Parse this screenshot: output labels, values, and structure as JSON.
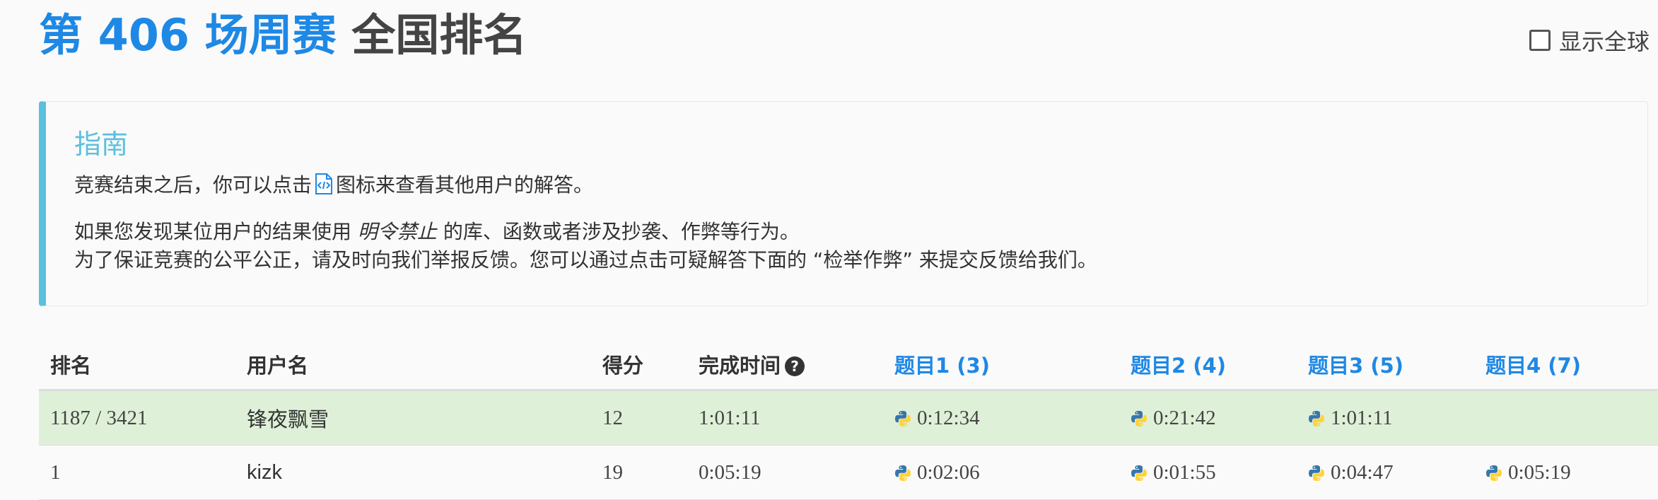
{
  "title": {
    "contest": "第 406 场周赛",
    "rest": "全国排名"
  },
  "global_toggle": {
    "label": "显示全球",
    "checked": false
  },
  "guide": {
    "heading": "指南",
    "line1_before": "竞赛结束之后，你可以点击",
    "line1_after": "图标来查看其他用户的解答。",
    "line2_before": "如果您发现某位用户的结果使用",
    "line2_emph": "明令禁止",
    "line2_after": "的库、函数或者涉及抄袭、作弊等行为。",
    "line3": "为了保证竞赛的公平公正，请及时向我们举报反馈。您可以通过点击可疑解答下面的 “检举作弊” 来提交反馈给我们。",
    "doc_icon": "code-document-icon"
  },
  "table": {
    "headers": {
      "rank": "排名",
      "username": "用户名",
      "score": "得分",
      "finish_time": "完成时间",
      "q1": "题目1 (3)",
      "q2": "题目2 (4)",
      "q3": "题目3 (5)",
      "q4": "题目4 (7)"
    },
    "rows": [
      {
        "rank": "1187 / 3421",
        "user": "锋夜飘雪",
        "score": "12",
        "finish": "1:01:11",
        "q1": "0:12:34",
        "q2": "0:21:42",
        "q3": "1:01:11",
        "q4": ""
      },
      {
        "rank": "1",
        "user": "kizk",
        "score": "19",
        "finish": "0:05:19",
        "q1": "0:02:06",
        "q2": "0:01:55",
        "q3": "0:04:47",
        "q4": "0:05:19"
      }
    ],
    "language_icon": "python-icon"
  },
  "colors": {
    "accent": "#1e88e5",
    "guide_border": "#5bc0de",
    "my_row": "#dff0d8"
  }
}
